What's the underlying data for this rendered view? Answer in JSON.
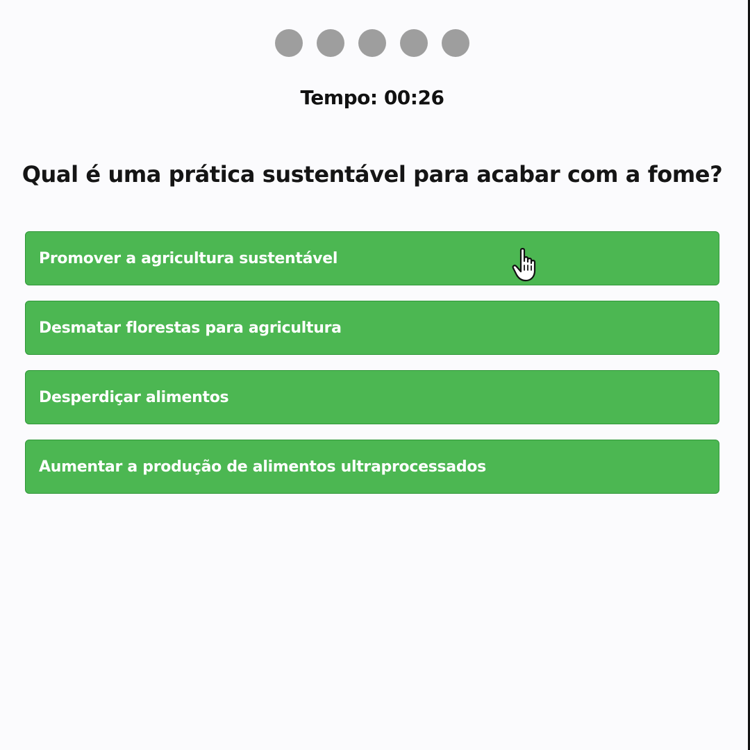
{
  "progress": {
    "total_steps": 5,
    "dot_color": "#9e9e9e"
  },
  "timer": {
    "text": "Tempo: 00:26"
  },
  "quiz": {
    "question": "Qual é uma prática sustentável para acabar com a fome?",
    "answers": [
      {
        "label": "Promover a agricultura sustentável"
      },
      {
        "label": "Desmatar florestas para agricultura"
      },
      {
        "label": "Desperdiçar alimentos"
      },
      {
        "label": "Aumentar a produção de alimentos ultraprocessados"
      }
    ]
  },
  "colors": {
    "answer_background": "#4cb752",
    "answer_border": "#2f9638",
    "answer_text": "#ffffff",
    "background": "#fbfbfd"
  },
  "cursor": {
    "icon": "hand-pointer-icon"
  }
}
